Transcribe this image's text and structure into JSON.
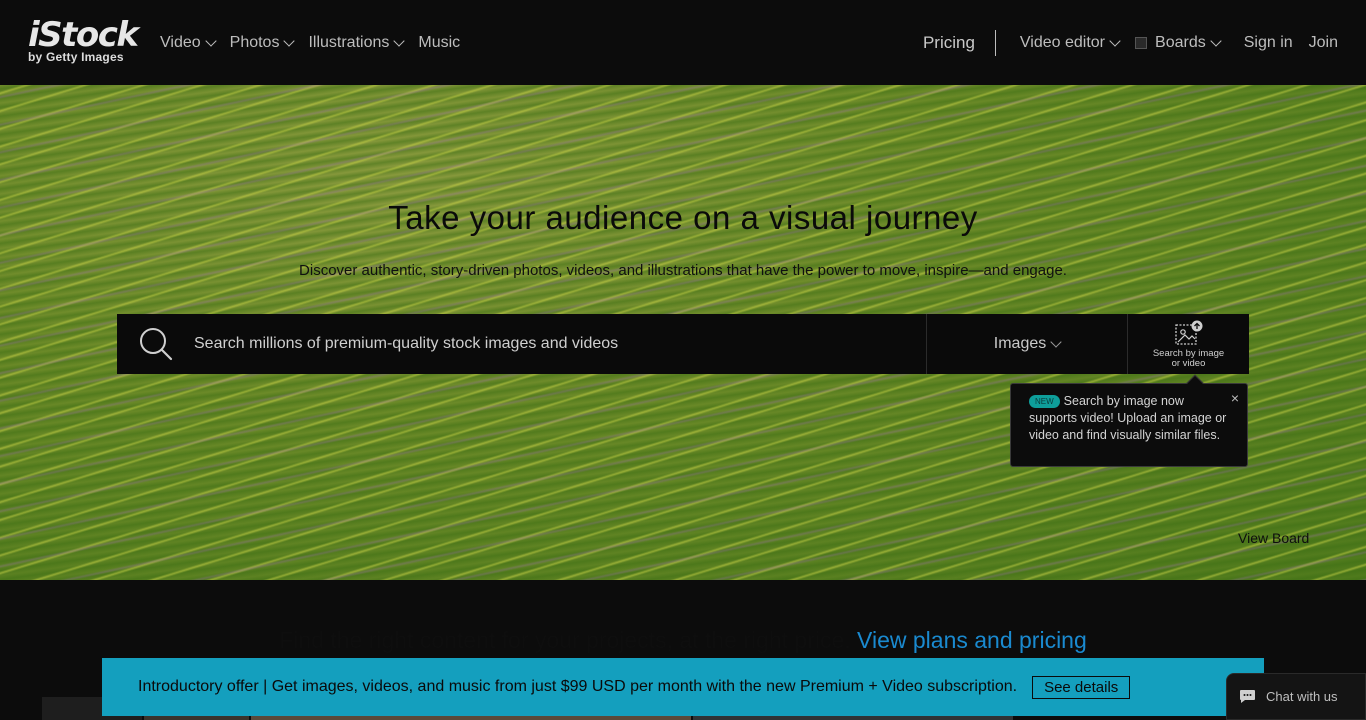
{
  "header": {
    "logo_main": "iStock",
    "logo_sub": "by Getty Images",
    "nav_left": [
      {
        "label": "Video",
        "dropdown": true
      },
      {
        "label": "Photos",
        "dropdown": true
      },
      {
        "label": "Illustrations",
        "dropdown": true
      },
      {
        "label": "Music",
        "dropdown": false
      }
    ],
    "pricing": "Pricing",
    "video_editor": "Video editor",
    "boards": "Boards",
    "sign_in": "Sign in",
    "join": "Join"
  },
  "hero": {
    "title": "Take your audience on a visual journey",
    "subtitle": "Discover authentic, story-driven photos, videos, and illustrations that have the power to move, inspire—and engage.",
    "search": {
      "placeholder": "Search millions of premium-quality stock images and videos",
      "type_selected": "Images",
      "image_search_label_1": "Search by image",
      "image_search_label_2": "or video"
    },
    "tooltip": {
      "badge": "NEW",
      "text": "Search by image now supports video! Upload an image or video and find visually similar files.",
      "close": "×"
    },
    "view_board": "View Board"
  },
  "plans": {
    "text": "Find the right content for your projects, at the right price.",
    "link": "View plans and pricing"
  },
  "offer": {
    "text": "Introductory offer | Get images, videos, and music from just $99 USD per month with the new Premium + Video subscription.",
    "button": "See details"
  },
  "chat": {
    "label": "Chat with us"
  },
  "colors": {
    "header_bg": "#0c0c0c",
    "offer_bg": "#149fbe",
    "link": "#1a8ad0",
    "badge": "#0e9e9a"
  }
}
